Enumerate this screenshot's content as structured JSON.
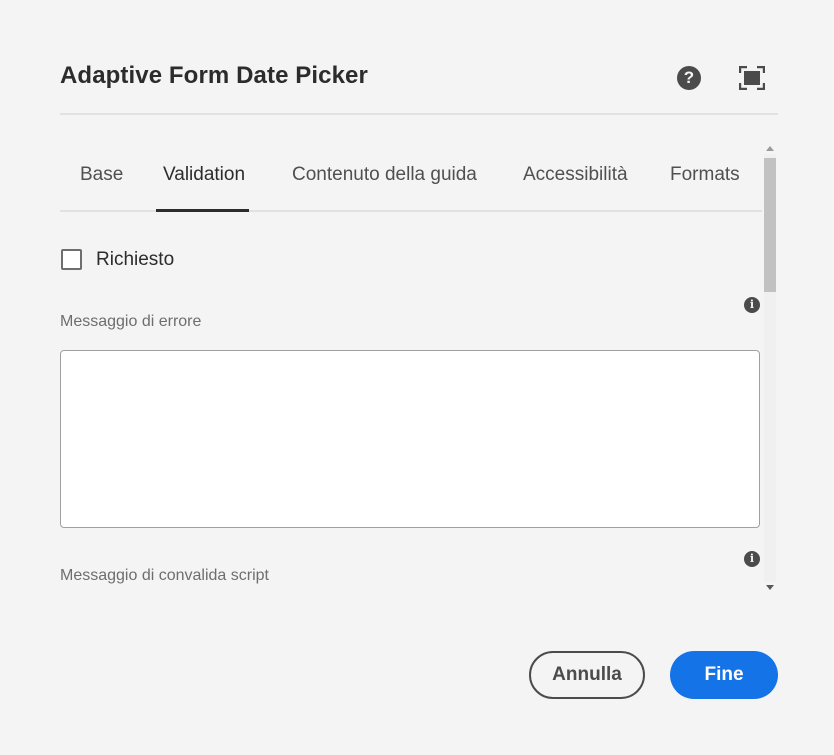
{
  "dialog": {
    "title": "Adaptive Form Date Picker",
    "help_icon": "question-circle-icon",
    "help_glyph": "?",
    "fullscreen_icon": "fullscreen-icon"
  },
  "tabs": [
    {
      "label": "Base",
      "active": false
    },
    {
      "label": "Validation",
      "active": true
    },
    {
      "label": "Contenuto della guida",
      "active": false
    },
    {
      "label": "Accessibilità",
      "active": false
    },
    {
      "label": "Formats",
      "active": false
    }
  ],
  "validation": {
    "required_label": "Richiesto",
    "required_checked": false,
    "error_message_label": "Messaggio di errore",
    "error_message_value": "",
    "script_message_label": "Messaggio di convalida script",
    "info_glyph": "i"
  },
  "footer": {
    "cancel_label": "Annulla",
    "done_label": "Fine"
  },
  "colors": {
    "primary": "#1473e6",
    "background": "#f4f4f4",
    "text": "#2c2c2c"
  }
}
